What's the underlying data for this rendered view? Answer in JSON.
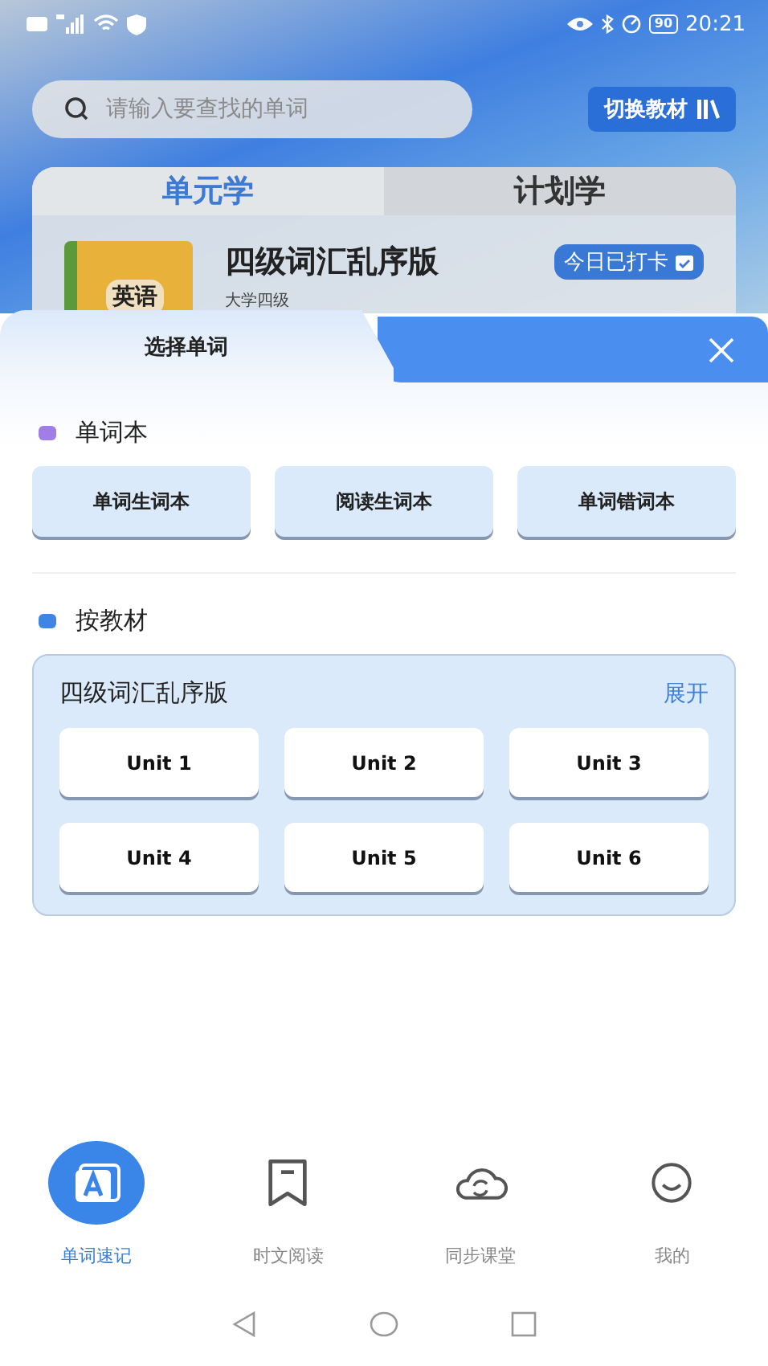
{
  "status_bar": {
    "time": "20:21",
    "battery": "90"
  },
  "search": {
    "placeholder": "请输入要查找的单词"
  },
  "switch_button": {
    "label": "切换教材"
  },
  "mode_tabs": [
    {
      "label": "单元学",
      "selected": true
    },
    {
      "label": "计划学",
      "selected": false
    }
  ],
  "current_book": {
    "cover_text": "英语",
    "title": "四级词汇乱序版",
    "subtitle": "大学四级",
    "checkin_badge": "今日已打卡"
  },
  "sheet": {
    "title": "选择单词",
    "sections": [
      {
        "kind": "buttons",
        "title": "单词本",
        "color": "#a07ee6",
        "items": [
          "单词生词本",
          "阅读生词本",
          "单词错词本"
        ]
      },
      {
        "kind": "textbook",
        "title": "按教材",
        "color": "#3d86e4",
        "book_title": "四级词汇乱序版",
        "expand_link": "展开",
        "units": [
          "Unit 1",
          "Unit 2",
          "Unit 3",
          "Unit 4",
          "Unit 5",
          "Unit 6"
        ]
      }
    ]
  },
  "bottom_nav": [
    {
      "kind": "flashcard",
      "label": "单词速记",
      "selected": true
    },
    {
      "kind": "bookmark",
      "label": "时文阅读",
      "selected": false
    },
    {
      "kind": "cloud-sync",
      "label": "同步课堂",
      "selected": false
    },
    {
      "kind": "smiley",
      "label": "我的",
      "selected": false
    }
  ]
}
